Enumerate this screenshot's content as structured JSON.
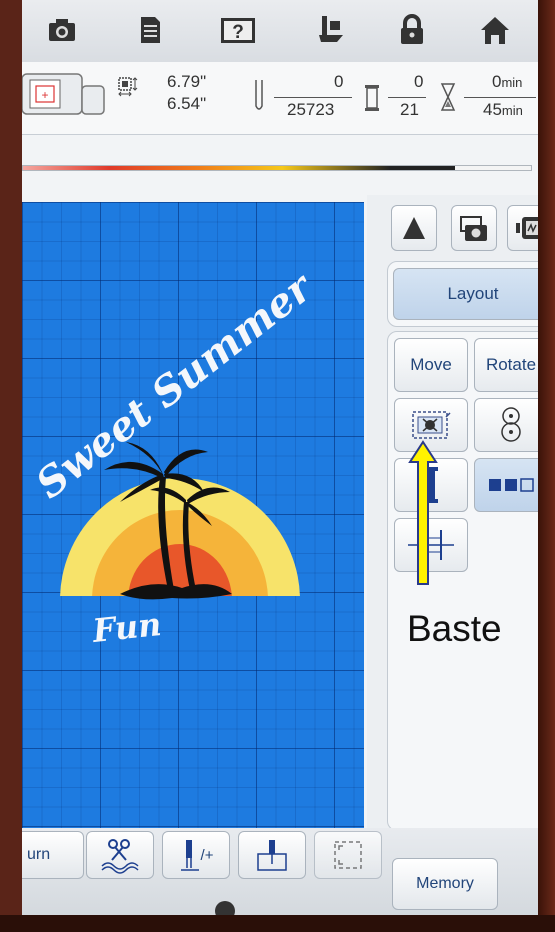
{
  "toolbar": {
    "items": [
      {
        "name": "camera-icon"
      },
      {
        "name": "document-icon"
      },
      {
        "name": "help-icon",
        "label": "?"
      },
      {
        "name": "presser-foot-icon"
      },
      {
        "name": "lock-icon"
      },
      {
        "name": "home-icon"
      }
    ]
  },
  "info": {
    "width": "6.79\"",
    "height": "6.54\"",
    "stitch_current": "0",
    "stitch_total": "25723",
    "color_current": "0",
    "color_total": "21",
    "time_current": "0",
    "time_total": "45",
    "time_unit": "min"
  },
  "progress": {
    "fraction": 0.85
  },
  "design": {
    "top_text": "Sweet Summer",
    "bottom_text": "Fun",
    "colors": {
      "background": "#1e7be0",
      "sun_outer": "#f7e36a",
      "sun_mid": "#f5b43a",
      "sun_inner": "#e8572a",
      "palm": "#111111",
      "text": "#f4f7fb"
    }
  },
  "sidepanel": {
    "layout_label": "Layout",
    "move_label": "Move",
    "rotate_label": "Rotate"
  },
  "bottombar": {
    "partial_label": "urn",
    "memory_label": "Memory",
    "stitch_sub_label": "/+"
  },
  "annotation": {
    "label": "Baste",
    "arrow_color": "#fff200"
  }
}
